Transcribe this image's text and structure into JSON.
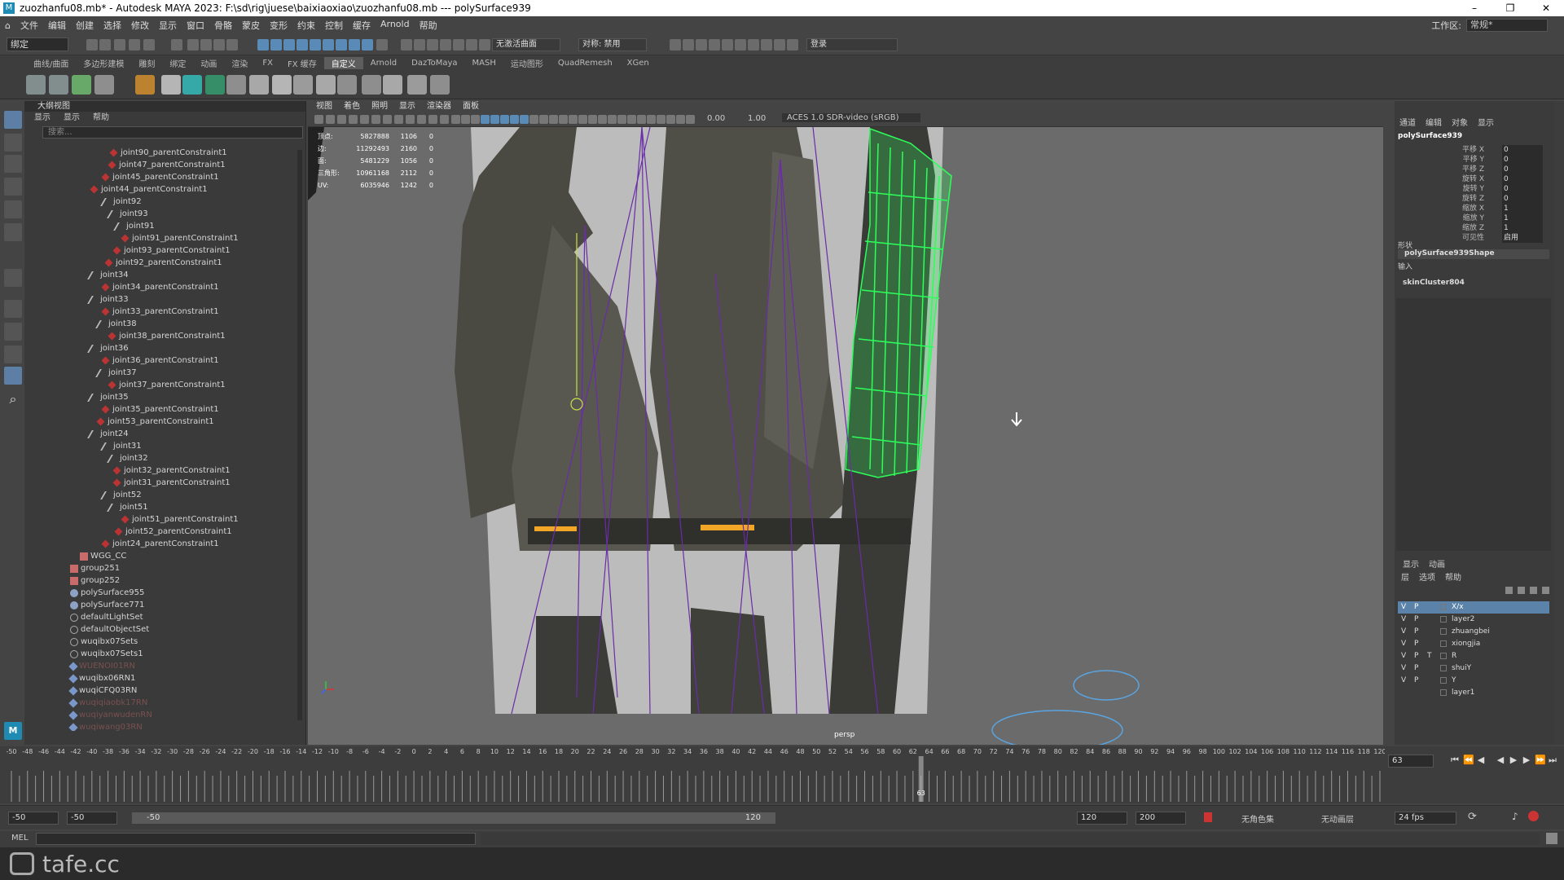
{
  "titlebar": {
    "title": "zuozhanfu08.mb* - Autodesk MAYA 2023: F:\\sd\\rig\\juese\\baixiaoxiao\\zuozhanfu08.mb  ---  polySurface939",
    "minimize": "–",
    "maximize": "❐",
    "close": "✕"
  },
  "menubar": {
    "items": [
      "文件",
      "编辑",
      "创建",
      "选择",
      "修改",
      "显示",
      "窗口",
      "骨骼",
      "蒙皮",
      "变形",
      "约束",
      "控制",
      "缓存",
      "Arnold",
      "帮助"
    ],
    "workspace_label": "工作区:",
    "workspace_value": "常规*"
  },
  "statusline": {
    "mode": "绑定",
    "camera_field": "无激活曲面",
    "symmetry": "对称: 禁用",
    "login": "登录"
  },
  "shelf": {
    "tabs": [
      "曲线/曲面",
      "多边形建模",
      "雕刻",
      "绑定",
      "动画",
      "渲染",
      "FX",
      "FX 缓存",
      "自定义",
      "Arnold",
      "DazToMaya",
      "MASH",
      "运动图形",
      "QuadRemesh",
      "XGen"
    ],
    "active_tab": "自定义"
  },
  "outliner": {
    "title": "大纲视图",
    "menu": [
      "显示",
      "显示",
      "帮助"
    ],
    "search_placeholder": "搜索...",
    "rows": [
      {
        "label": "joint90_parentConstraint1",
        "type": "constraint"
      },
      {
        "label": "joint47_parentConstraint1",
        "type": "constraint"
      },
      {
        "label": "joint45_parentConstraint1",
        "type": "constraint"
      },
      {
        "label": "joint44_parentConstraint1",
        "type": "constraint"
      },
      {
        "label": "joint92",
        "type": "joint"
      },
      {
        "label": "joint93",
        "type": "joint"
      },
      {
        "label": "joint91",
        "type": "joint"
      },
      {
        "label": "joint91_parentConstraint1",
        "type": "constraint"
      },
      {
        "label": "joint93_parentConstraint1",
        "type": "constraint"
      },
      {
        "label": "joint92_parentConstraint1",
        "type": "constraint"
      },
      {
        "label": "joint34",
        "type": "joint"
      },
      {
        "label": "joint34_parentConstraint1",
        "type": "constraint"
      },
      {
        "label": "joint33",
        "type": "joint"
      },
      {
        "label": "joint33_parentConstraint1",
        "type": "constraint"
      },
      {
        "label": "joint38",
        "type": "joint"
      },
      {
        "label": "joint38_parentConstraint1",
        "type": "constraint"
      },
      {
        "label": "joint36",
        "type": "joint"
      },
      {
        "label": "joint36_parentConstraint1",
        "type": "constraint"
      },
      {
        "label": "joint37",
        "type": "joint"
      },
      {
        "label": "joint37_parentConstraint1",
        "type": "constraint"
      },
      {
        "label": "joint35",
        "type": "joint"
      },
      {
        "label": "joint35_parentConstraint1",
        "type": "constraint"
      },
      {
        "label": "joint53_parentConstraint1",
        "type": "constraint"
      },
      {
        "label": "joint24",
        "type": "joint"
      },
      {
        "label": "joint31",
        "type": "joint"
      },
      {
        "label": "joint32",
        "type": "joint"
      },
      {
        "label": "joint32_parentConstraint1",
        "type": "constraint"
      },
      {
        "label": "joint31_parentConstraint1",
        "type": "constraint"
      },
      {
        "label": "joint52",
        "type": "joint"
      },
      {
        "label": "joint51",
        "type": "joint"
      },
      {
        "label": "joint51_parentConstraint1",
        "type": "constraint"
      },
      {
        "label": "joint52_parentConstraint1",
        "type": "constraint"
      },
      {
        "label": "joint24_parentConstraint1",
        "type": "constraint"
      },
      {
        "label": "WGG_CC",
        "type": "group"
      },
      {
        "label": "group251",
        "type": "group"
      },
      {
        "label": "group252",
        "type": "group"
      },
      {
        "label": "polySurface955",
        "type": "mesh"
      },
      {
        "label": "polySurface771",
        "type": "mesh"
      },
      {
        "label": "defaultLightSet",
        "type": "set"
      },
      {
        "label": "defaultObjectSet",
        "type": "set"
      },
      {
        "label": "wuqibx07Sets",
        "type": "set"
      },
      {
        "label": "wuqibx07Sets1",
        "type": "set"
      },
      {
        "label": "WUENOI01RN",
        "type": "ref",
        "dim": true
      },
      {
        "label": "wuqibx06RN1",
        "type": "ref"
      },
      {
        "label": "wuqiCFQ03RN",
        "type": "ref"
      },
      {
        "label": "wuqiqiaobk17RN",
        "type": "ref",
        "dim": true
      },
      {
        "label": "wuqiyanwudenRN",
        "type": "ref",
        "dim": true
      },
      {
        "label": "wuqiwang03RN",
        "type": "ref",
        "dim": true
      }
    ]
  },
  "viewport": {
    "menu": [
      "视图",
      "着色",
      "照明",
      "显示",
      "渲染器",
      "面板"
    ],
    "exposure": "0.00",
    "gamma": "1.00",
    "colorspace": "ACES 1.0 SDR-video (sRGB)",
    "hud": [
      [
        "顶点:",
        "5827888",
        "1106",
        "0"
      ],
      [
        "边:",
        "11292493",
        "2160",
        "0"
      ],
      [
        "面:",
        "5481229",
        "1056",
        "0"
      ],
      [
        "三角形:",
        "10961168",
        "2112",
        "0"
      ],
      [
        "UV:",
        "6035946",
        "1242",
        "0"
      ]
    ],
    "camera_label": "persp"
  },
  "channelbox": {
    "menu": [
      "通道",
      "编辑",
      "对象",
      "显示"
    ],
    "object": "polySurface939",
    "attrs": [
      {
        "name": "平移 X",
        "value": "0"
      },
      {
        "name": "平移 Y",
        "value": "0"
      },
      {
        "name": "平移 Z",
        "value": "0"
      },
      {
        "name": "旋转 X",
        "value": "0"
      },
      {
        "name": "旋转 Y",
        "value": "0"
      },
      {
        "name": "旋转 Z",
        "value": "0"
      },
      {
        "name": "缩放 X",
        "value": "1"
      },
      {
        "name": "缩放 Y",
        "value": "1"
      },
      {
        "name": "缩放 Z",
        "value": "1"
      },
      {
        "name": "可见性",
        "value": "启用"
      }
    ],
    "shapes_label": "形状",
    "shape_name": "polySurface939Shape",
    "inputs_label": "输入",
    "input_name": "skinCluster804"
  },
  "layers": {
    "tabs": [
      "显示",
      "动画"
    ],
    "menu": [
      "层",
      "选项",
      "帮助"
    ],
    "rows": [
      {
        "v": "V",
        "p": "P",
        "t": "",
        "name": "X/x",
        "selected": true
      },
      {
        "v": "V",
        "p": "P",
        "t": "",
        "name": "layer2"
      },
      {
        "v": "V",
        "p": "P",
        "t": "",
        "name": "zhuangbei"
      },
      {
        "v": "V",
        "p": "P",
        "t": "",
        "name": "xiongjia"
      },
      {
        "v": "V",
        "p": "P",
        "t": "T",
        "name": "R"
      },
      {
        "v": "V",
        "p": "P",
        "t": "",
        "name": "shuiY"
      },
      {
        "v": "V",
        "p": "P",
        "t": "",
        "name": "Y"
      },
      {
        "v": "",
        "p": "",
        "t": "",
        "name": "layer1"
      }
    ]
  },
  "timeline": {
    "ticks": [
      "-50",
      "-48",
      "-46",
      "-44",
      "-42",
      "-40",
      "-38",
      "-36",
      "-34",
      "-32",
      "-30",
      "-28",
      "-26",
      "-24",
      "-22",
      "-20",
      "-18",
      "-16",
      "-14",
      "-12",
      "-10",
      "-8",
      "-6",
      "-4",
      "-2",
      "0",
      "2",
      "4",
      "6",
      "8",
      "10",
      "12",
      "14",
      "16",
      "18",
      "20",
      "22",
      "24",
      "26",
      "28",
      "30",
      "32",
      "34",
      "36",
      "38",
      "40",
      "42",
      "44",
      "46",
      "48",
      "50",
      "52",
      "54",
      "56",
      "58",
      "60",
      "62",
      "64",
      "66",
      "68",
      "70",
      "72",
      "74",
      "76",
      "78",
      "80",
      "82",
      "84",
      "86",
      "88",
      "90",
      "92",
      "94",
      "96",
      "98",
      "100",
      "102",
      "104",
      "106",
      "108",
      "110",
      "112",
      "114",
      "116",
      "118",
      "120"
    ],
    "current_frame": "63",
    "current_frame_field": "63"
  },
  "range": {
    "start": "-50",
    "anim_start": "-50",
    "slider_start": "-50",
    "slider_end": "120",
    "anim_end": "120",
    "end": "200",
    "character_set": "无角色集",
    "anim_layer": "无动画层",
    "fps": "24 fps"
  },
  "cmdline": {
    "label": "MEL"
  },
  "watermark": "tafe.cc"
}
